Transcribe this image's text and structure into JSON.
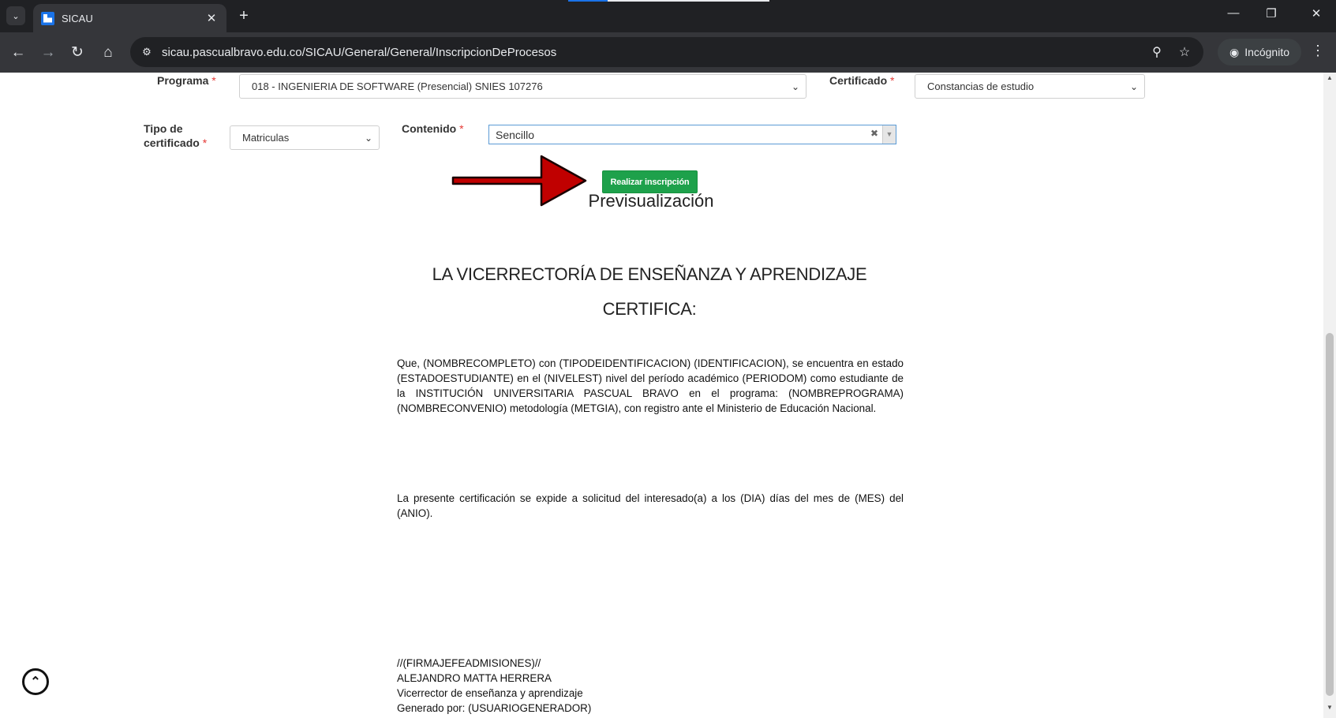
{
  "browser": {
    "tab_title": "SICAU",
    "url": "sicau.pascualbravo.edu.co/SICAU/General/General/InscripcionDeProcesos",
    "incognito_label": "Incógnito"
  },
  "form": {
    "programa_label": "Programa",
    "programa_value": "018 - INGENIERIA DE SOFTWARE (Presencial) SNIES 107276",
    "certificado_label": "Certificado",
    "certificado_value": "Constancias de estudio",
    "tipo_label_line1": "Tipo de",
    "tipo_label_line2": "certificado",
    "tipo_value": "Matriculas",
    "contenido_label": "Contenido",
    "contenido_value": "Sencillo",
    "required_mark": "*",
    "submit_label": "Realizar inscripción"
  },
  "preview": {
    "title": "Previsualización",
    "heading": "LA VICERRECTORÍA DE ENSEÑANZA Y APRENDIZAJE",
    "subheading": "CERTIFICA:",
    "paragraph1": "Que, (NOMBRECOMPLETO) con (TIPODEIDENTIFICACION) (IDENTIFICACION), se encuentra en estado (ESTADOESTUDIANTE) en el (NIVELEST) nivel del período académico (PERIODOM) como estudiante de la INSTITUCIÓN UNIVERSITARIA PASCUAL BRAVO en el programa: (NOMBREPROGRAMA) (NOMBRECONVENIO) metodología (METGIA), con registro ante el Ministerio de Educación Nacional.",
    "paragraph2": "La presente certificación se expide a solicitud del interesado(a) a los (DIA) días del mes de (MES) del (ANIO).",
    "signature_placeholder": "//(FIRMAJEFEADMISIONES)//",
    "signer_name": "ALEJANDRO MATTA HERRERA",
    "signer_role": "Vicerrector de enseñanza y aprendizaje",
    "generated_by": "Generado por: (USUARIOGENERADOR)"
  },
  "colors": {
    "submit_button": "#1ea14b",
    "required": "#e53935",
    "annotation_arrow": "#c00000"
  }
}
